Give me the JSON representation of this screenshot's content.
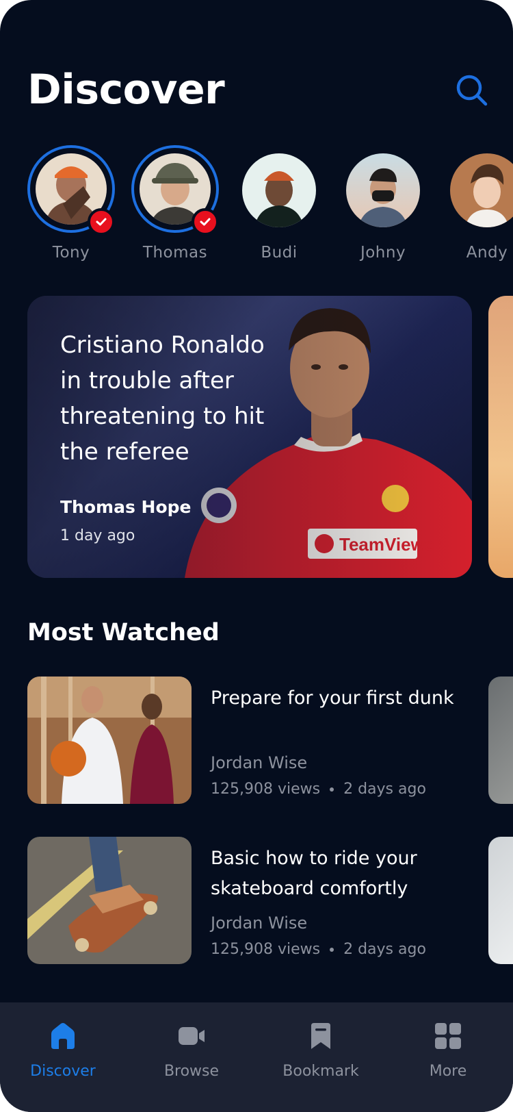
{
  "header": {
    "title": "Discover",
    "search_icon": "search-icon"
  },
  "stories": [
    {
      "name": "Tony",
      "seen": true
    },
    {
      "name": "Thomas",
      "seen": true
    },
    {
      "name": "Budi",
      "seen": false
    },
    {
      "name": "Johny",
      "seen": false
    },
    {
      "name": "Andy",
      "seen": false
    }
  ],
  "featured": {
    "headline": "Cristiano Ronaldo in trouble after threatening to hit the referee",
    "author": "Thomas Hope",
    "time": "1 day ago"
  },
  "most_watched": {
    "title": "Most Watched",
    "items": [
      {
        "title": "Prepare for your first dunk",
        "author": "Jordan Wise",
        "views": "125,908 views",
        "time": "2 days ago"
      },
      {
        "title": "Basic how to ride your skateboard comfortly",
        "author": "Jordan Wise",
        "views": "125,908 views",
        "time": "2 days ago"
      }
    ]
  },
  "bottom_nav": [
    {
      "label": "Discover",
      "icon": "home-icon",
      "active": true
    },
    {
      "label": "Browse",
      "icon": "video-camera-icon",
      "active": false
    },
    {
      "label": "Bookmark",
      "icon": "bookmark-icon",
      "active": false
    },
    {
      "label": "More",
      "icon": "grid-icon",
      "active": false
    }
  ],
  "colors": {
    "background": "#050d1e",
    "accent": "#1d7ee8",
    "badge": "#e8101e",
    "nav_bg": "#1c2233"
  }
}
